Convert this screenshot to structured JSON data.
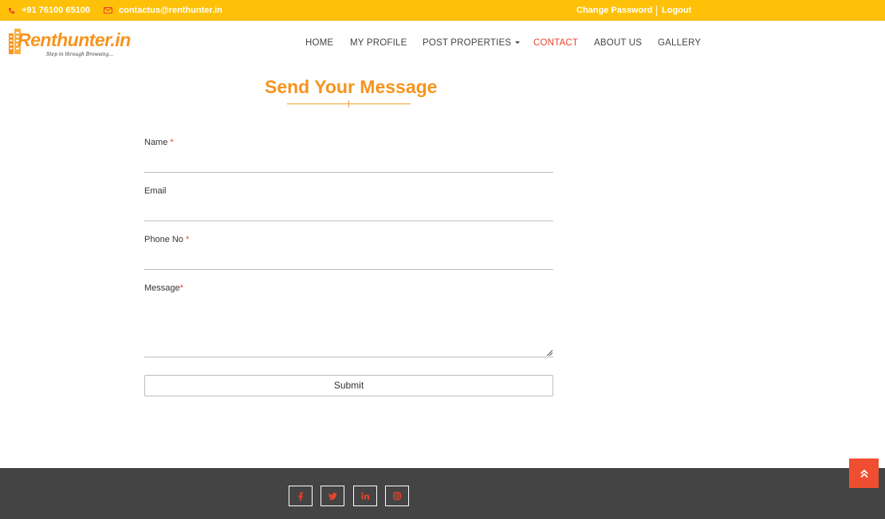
{
  "topbar": {
    "phone": "+91 76100 65100",
    "email": "contactus@renthunter.in",
    "change_password": "Change Password",
    "logout": "Logout"
  },
  "brand": {
    "name": "Renthunter",
    "suffix": ".in",
    "tagline": "Step in through Browsing..."
  },
  "nav": {
    "items": [
      {
        "label": "HOME"
      },
      {
        "label": "MY PROFILE"
      },
      {
        "label": "POST PROPERTIES"
      },
      {
        "label": "CONTACT"
      },
      {
        "label": "ABOUT US"
      },
      {
        "label": "GALLERY"
      }
    ],
    "active": "CONTACT"
  },
  "form": {
    "title": "Send Your Message",
    "name_label": "Name",
    "email_label": "Email",
    "phone_label": "Phone No",
    "message_label": "Message",
    "required_mark": "*",
    "submit_label": "Submit"
  },
  "footer": {
    "social": [
      {
        "icon": "facebook-icon",
        "glyph": "f"
      },
      {
        "icon": "twitter-icon",
        "glyph": "t"
      },
      {
        "icon": "linkedin-icon",
        "glyph": "in"
      },
      {
        "icon": "instagram-icon",
        "glyph": "ig"
      }
    ]
  },
  "colors": {
    "topbar": "#ffc107",
    "brand_orange": "#f7941d",
    "accent_red": "#e8432c",
    "footer": "#444444",
    "scroll_top": "#f04e30"
  }
}
